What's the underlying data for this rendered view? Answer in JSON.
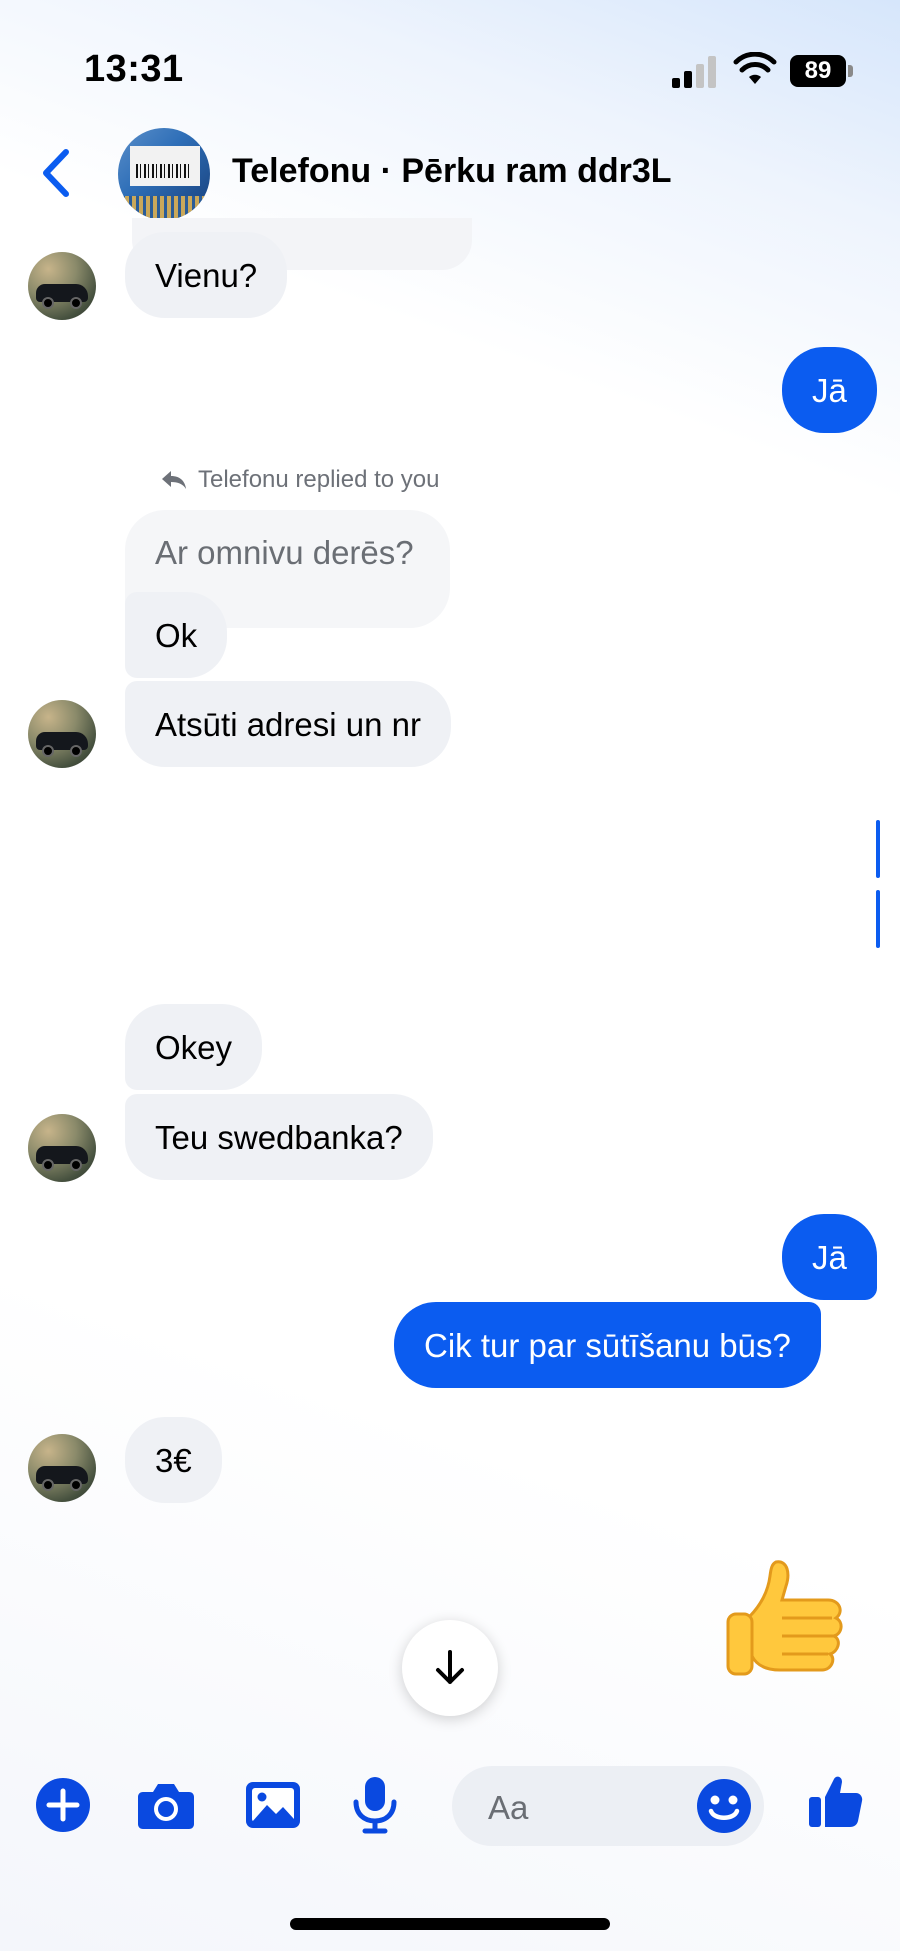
{
  "status_bar": {
    "time": "13:31",
    "battery": "89"
  },
  "header": {
    "title": "Telefonu · Pērku ram ddr3L"
  },
  "messages": {
    "m1": "Vienu?",
    "m2": "Jā",
    "reply_note": "Telefonu replied to you",
    "m3_quoted": "Ar omnivu derēs?",
    "m4": "Ok",
    "m5": "Atsūti adresi un nr",
    "m6": "Okey",
    "m7": "Teu swedbanka?",
    "m8": "Jā",
    "m9": "Cik tur par sūtīšanu būs?",
    "m10": "3€"
  },
  "composer": {
    "placeholder": "Aa"
  },
  "colors": {
    "accent": "#0b5cf0",
    "incoming_bubble": "#eff1f5"
  },
  "icons": [
    "back-icon",
    "plus-icon",
    "camera-icon",
    "gallery-icon",
    "mic-icon",
    "emoji-icon",
    "like-icon",
    "arrow-down-icon",
    "thumbs-up-emoji"
  ]
}
